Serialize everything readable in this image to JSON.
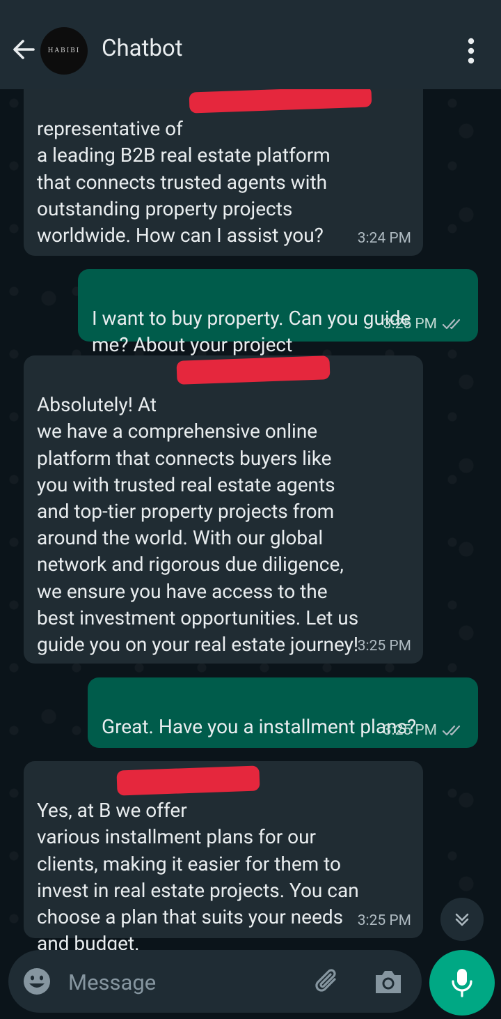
{
  "header": {
    "title": "Chatbot",
    "avatar_text": "HABIBI"
  },
  "messages": [
    {
      "dir": "in",
      "text": "representative of\na leading B2B real estate platform\nthat connects trusted agents with\noutstanding property projects\nworldwide. How can I assist you?",
      "time": "3:24 PM"
    },
    {
      "dir": "out",
      "text": "I want to buy property. Can you guide\nme? About your project",
      "time": "3:25 PM"
    },
    {
      "dir": "in",
      "text": "Absolutely! At\nwe have a comprehensive online\nplatform that connects buyers like\nyou with trusted real estate agents\nand top-tier property projects from\naround the world. With our global\nnetwork and rigorous due diligence,\nwe ensure you have access to the\nbest investment opportunities. Let us\nguide you on your real estate journey!",
      "time": "3:25 PM"
    },
    {
      "dir": "out",
      "text": "Great. Have you a installment plans?",
      "time": "3:25 PM"
    },
    {
      "dir": "in",
      "text": "Yes, at B                      we offer\nvarious installment plans for our\nclients, making it easier for them to\ninvest in real estate projects. You can\nchoose a plan that suits your needs\nand budget.",
      "time": "3:25 PM"
    }
  ],
  "composer": {
    "placeholder": "Message"
  },
  "colors": {
    "incoming_bubble": "#202c33",
    "outgoing_bubble": "#005c4b",
    "accent": "#00a884",
    "redaction": "#e5273d"
  }
}
